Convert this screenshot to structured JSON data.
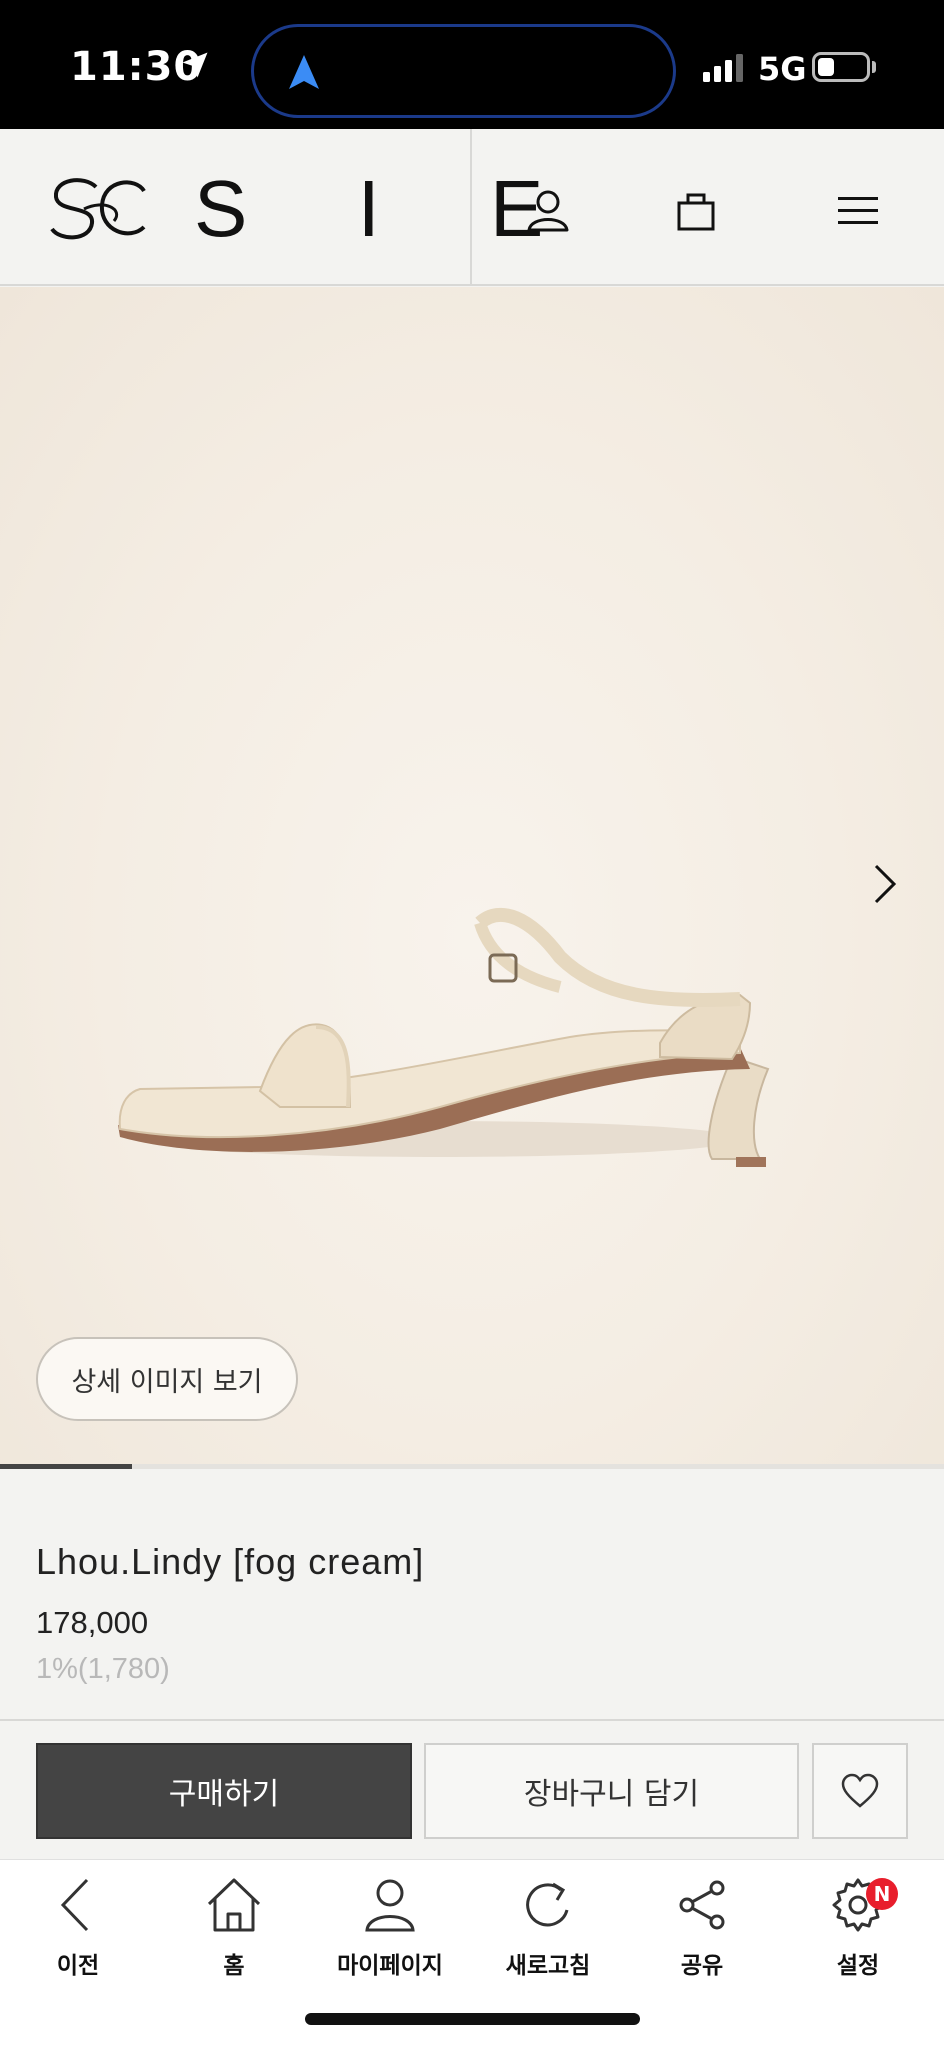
{
  "status_bar": {
    "time": "11:30",
    "network": "5G",
    "icons": [
      "location-arrow-icon",
      "signal-icon",
      "battery-icon"
    ]
  },
  "header": {
    "brand": "S I E",
    "icons": [
      "user-icon",
      "shopping-bag-icon",
      "menu-icon"
    ]
  },
  "gallery": {
    "detail_button": "상세 이미지 보기",
    "progress": 0.14,
    "icons": [
      "chevron-right-icon"
    ]
  },
  "product": {
    "name": "Lhou.Lindy [fog cream]",
    "price": "178,000",
    "points": "1%(1,780)"
  },
  "actions": {
    "buy": "구매하기",
    "add_to_cart": "장바구니 담기",
    "icons": [
      "heart-icon"
    ]
  },
  "bottom_nav": {
    "items": [
      {
        "label": "이전",
        "icon": "back-icon"
      },
      {
        "label": "홈",
        "icon": "home-icon"
      },
      {
        "label": "마이페이지",
        "icon": "user-icon"
      },
      {
        "label": "새로고침",
        "icon": "refresh-icon"
      },
      {
        "label": "공유",
        "icon": "share-icon"
      },
      {
        "label": "설정",
        "icon": "settings-icon",
        "badge": "N"
      }
    ]
  },
  "colors": {
    "buy_button": "#444444",
    "badge": "#e81e2c",
    "island_border": "#1b3a8a",
    "nav_arrow": "#3b8cf5"
  }
}
